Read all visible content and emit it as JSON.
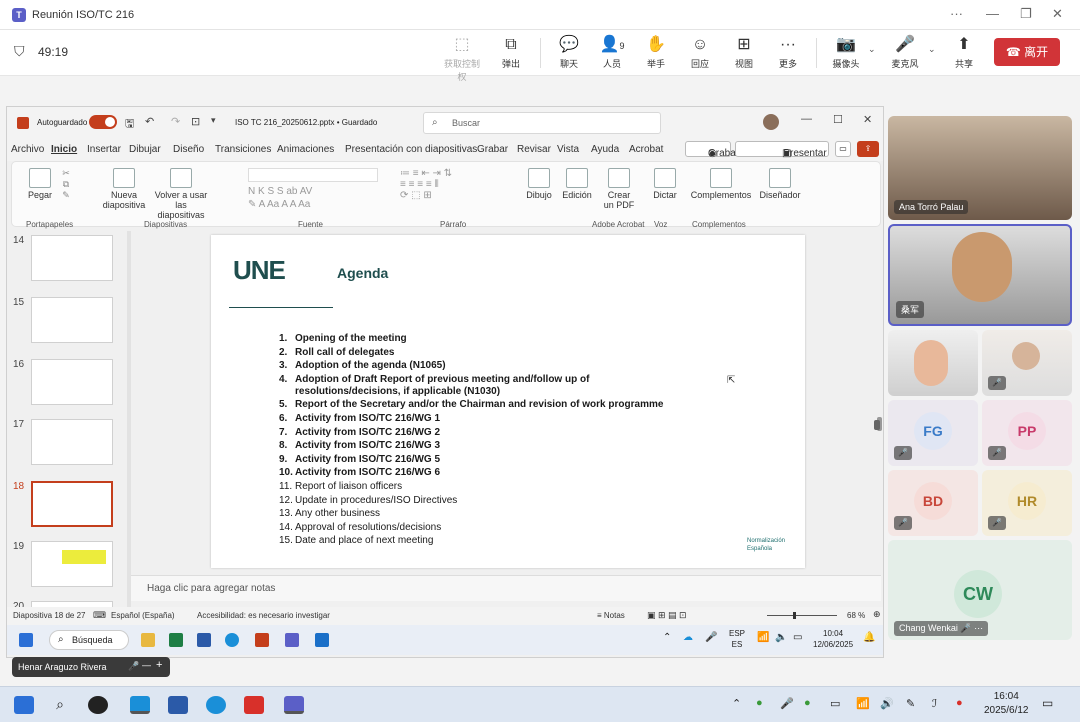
{
  "meeting": {
    "title": "Reunión ISO/TC 216",
    "timer": "49:19",
    "toolbar": [
      {
        "label": "获取控制权",
        "icon": "pointer-icon"
      },
      {
        "label": "弹出",
        "icon": "popout-icon"
      },
      {
        "label": "聊天",
        "icon": "chat-icon"
      },
      {
        "label": "人员",
        "icon": "people-icon",
        "count": "9"
      },
      {
        "label": "举手",
        "icon": "hand-icon"
      },
      {
        "label": "回应",
        "icon": "emoji-icon"
      },
      {
        "label": "视图",
        "icon": "grid-icon"
      },
      {
        "label": "更多",
        "icon": "more-icon"
      },
      {
        "label": "摄像头",
        "icon": "camera-off-icon"
      },
      {
        "label": "麦克风",
        "icon": "mic-off-icon"
      },
      {
        "label": "共享",
        "icon": "share-icon"
      }
    ],
    "leave_label": "离开"
  },
  "ppt": {
    "autosave": "Autoguardado",
    "file_name": "ISO TC 216_20250612.pptx • Guardado",
    "search_placeholder": "Buscar",
    "menu": [
      "Archivo",
      "Inicio",
      "Insertar",
      "Dibujar",
      "Diseño",
      "Transiciones",
      "Animaciones",
      "Presentación con diapositivas",
      "Grabar",
      "Revisar",
      "Vista",
      "Ayuda",
      "Acrobat"
    ],
    "record_label": "Grabar",
    "teams_label": "Presentar en Teams",
    "ribbon": {
      "paste": "Pegar",
      "new_slide": "Nueva diapositiva",
      "reuse": "Volver a usar las diapositivas",
      "draw": "Dibujo",
      "edit": "Edición",
      "create_pdf": "Crear un PDF",
      "dictate": "Dictar",
      "addins": "Complementos",
      "designer": "Diseñador",
      "groups": [
        "Portapapeles",
        "Diapositivas",
        "Fuente",
        "Párrafo",
        "Adobe Acrobat",
        "Voz",
        "Complementos"
      ]
    },
    "thumb_numbers": [
      "14",
      "15",
      "16",
      "17",
      "18",
      "19",
      "20"
    ],
    "notes_placeholder": "Haga clic para agregar notas",
    "status": {
      "slide": "Diapositiva 18 de 27",
      "language": "Español (España)",
      "accessibility": "Accesibilidad: es necesario investigar",
      "notes": "Notas",
      "zoom": "68 %"
    }
  },
  "slide": {
    "logo": "UNE",
    "title": "Agenda",
    "items": [
      {
        "num": "1.",
        "text": "Opening of the meeting",
        "bold": true
      },
      {
        "num": "2.",
        "text": "Roll call of delegates",
        "bold": true
      },
      {
        "num": "3.",
        "text": "Adoption of the agenda  (N1065)",
        "bold": true
      },
      {
        "num": "4.",
        "text": "Adoption of Draft Report of previous meeting and/follow up of",
        "bold": true
      },
      {
        "num": "",
        "text": "resolutions/decisions, if applicable (N1030)",
        "bold": true
      },
      {
        "num": "5.",
        "text": "Report of the Secretary and/or the Chairman and revision of work programme",
        "bold": true
      },
      {
        "num": "6.",
        "text": "Activity from ISO/TC 216/WG 1",
        "bold": true
      },
      {
        "num": "7.",
        "text": "Activity from ISO/TC 216/WG 2",
        "bold": true
      },
      {
        "num": "8.",
        "text": "Activity from ISO/TC 216/WG 3",
        "bold": true
      },
      {
        "num": "9.",
        "text": "Activity from ISO/TC 216/WG 5",
        "bold": true
      },
      {
        "num": "10.",
        "text": "Activity from ISO/TC 216/WG 6",
        "bold": true
      },
      {
        "num": "11.",
        "text": "Report of liaison officers",
        "bold": false
      },
      {
        "num": "12.",
        "text": "Update in procedures/ISO Directives",
        "bold": false
      },
      {
        "num": "13.",
        "text": "Any other business",
        "bold": false
      },
      {
        "num": "14.",
        "text": "Approval of resolutions/decisions",
        "bold": false
      },
      {
        "num": "15.",
        "text": "Date and place of next meeting",
        "bold": false
      }
    ],
    "footer_logo": "Normalización Española"
  },
  "remote_taskbar": {
    "search": "Búsqueda",
    "lang1": "ESP",
    "lang2": "ES",
    "time": "10:04",
    "date": "12/06/2025"
  },
  "presenter": {
    "name": "Henar Araguzo Rivera"
  },
  "participants": [
    {
      "name": "Ana Torró Palau",
      "type": "video"
    },
    {
      "name": "桑军",
      "type": "video"
    },
    {
      "name": "",
      "type": "video"
    },
    {
      "name": "",
      "type": "video"
    },
    {
      "initials": "FG",
      "color": "#3a7bc8"
    },
    {
      "initials": "PP",
      "color": "#c83a6a"
    },
    {
      "initials": "BD",
      "color": "#c8463a"
    },
    {
      "initials": "HR",
      "color": "#b08a2a"
    },
    {
      "initials": "CW",
      "name": "Chang Wenkai",
      "color": "#2e8a5a"
    }
  ],
  "taskbar": {
    "time": "16:04",
    "date": "2025/6/12"
  }
}
